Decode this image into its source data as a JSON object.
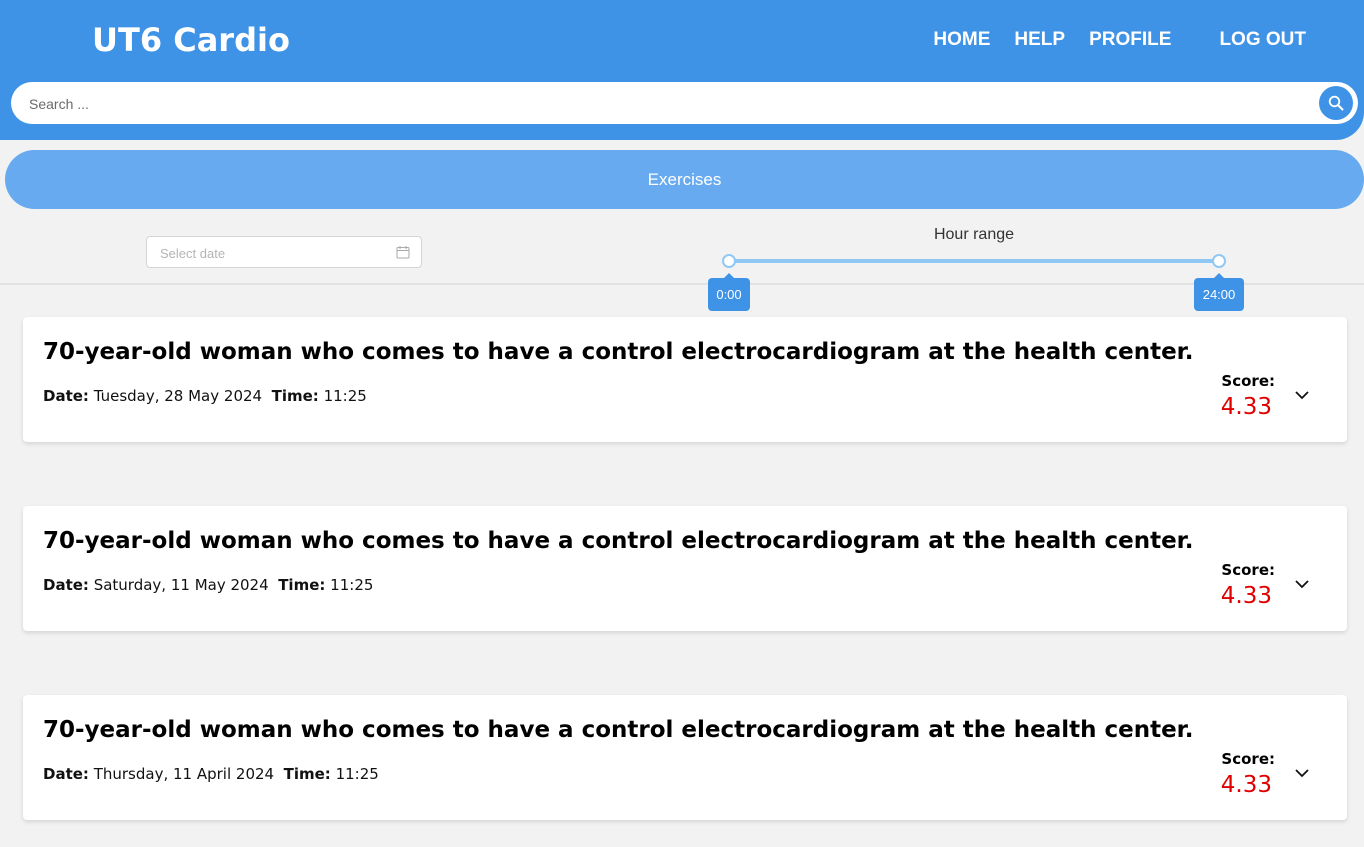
{
  "header": {
    "brand": "UT6 Cardio",
    "nav": [
      "HOME",
      "HELP",
      "PROFILE",
      "LOG OUT"
    ],
    "search_placeholder": "Search ..."
  },
  "tabs": [
    "Exercises"
  ],
  "filters": {
    "date_placeholder": "Select date",
    "hour_range_label": "Hour range",
    "hour_range_min": "0:00",
    "hour_range_max": "24:00",
    "hour_range_min_fraction": 0,
    "hour_range_max_fraction": 1
  },
  "cards": [
    {
      "title": "70-year-old woman who comes to have a control electrocardiogram at the health center.",
      "date_label": "Date:",
      "date": "Tuesday, 28 May 2024",
      "time_label": "Time:",
      "time": "11:25",
      "score_label": "Score:",
      "score": "4.33"
    },
    {
      "title": "70-year-old woman who comes to have a control electrocardiogram at the health center.",
      "date_label": "Date:",
      "date": "Saturday, 11 May 2024",
      "time_label": "Time:",
      "time": "11:25",
      "score_label": "Score:",
      "score": "4.33"
    },
    {
      "title": "70-year-old woman who comes to have a control electrocardiogram at the health center.",
      "date_label": "Date:",
      "date": "Thursday, 11 April 2024",
      "time_label": "Time:",
      "time": "11:25",
      "score_label": "Score:",
      "score": "4.33"
    }
  ],
  "icons": {
    "search": "search-icon",
    "calendar": "calendar-icon",
    "expand": "chevron-down-icon"
  },
  "colors": {
    "primary": "#3f93e6",
    "tab": "#68aaf0",
    "slider": "#90c8f3",
    "score": "#e00000"
  }
}
